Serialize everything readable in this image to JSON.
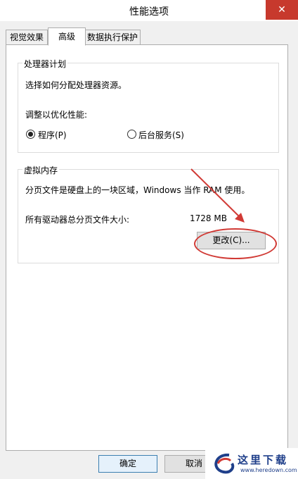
{
  "window": {
    "title": "性能选项",
    "close_glyph": "✕"
  },
  "tabs": [
    {
      "label": "视觉效果"
    },
    {
      "label": "高级"
    },
    {
      "label": "数据执行保护"
    }
  ],
  "processor": {
    "group_title": "处理器计划",
    "description": "选择如何分配处理器资源。",
    "adjust_label": "调整以优化性能:",
    "option_programs": "程序(P)",
    "option_services": "后台服务(S)",
    "selected": "programs"
  },
  "virtual_memory": {
    "group_title": "虚拟内存",
    "description": "分页文件是硬盘上的一块区域，Windows 当作 RAM 使用。",
    "total_label": "所有驱动器总分页文件大小:",
    "total_value": "1728 MB",
    "change_button": "更改(C)..."
  },
  "footer": {
    "ok": "确定",
    "cancel": "取消"
  },
  "watermark": {
    "text": "这里下载",
    "sub": "www.heredown.com"
  },
  "colors": {
    "annotation": "#d13a35",
    "close": "#c7392d",
    "watermark": "#1f3f8a"
  }
}
